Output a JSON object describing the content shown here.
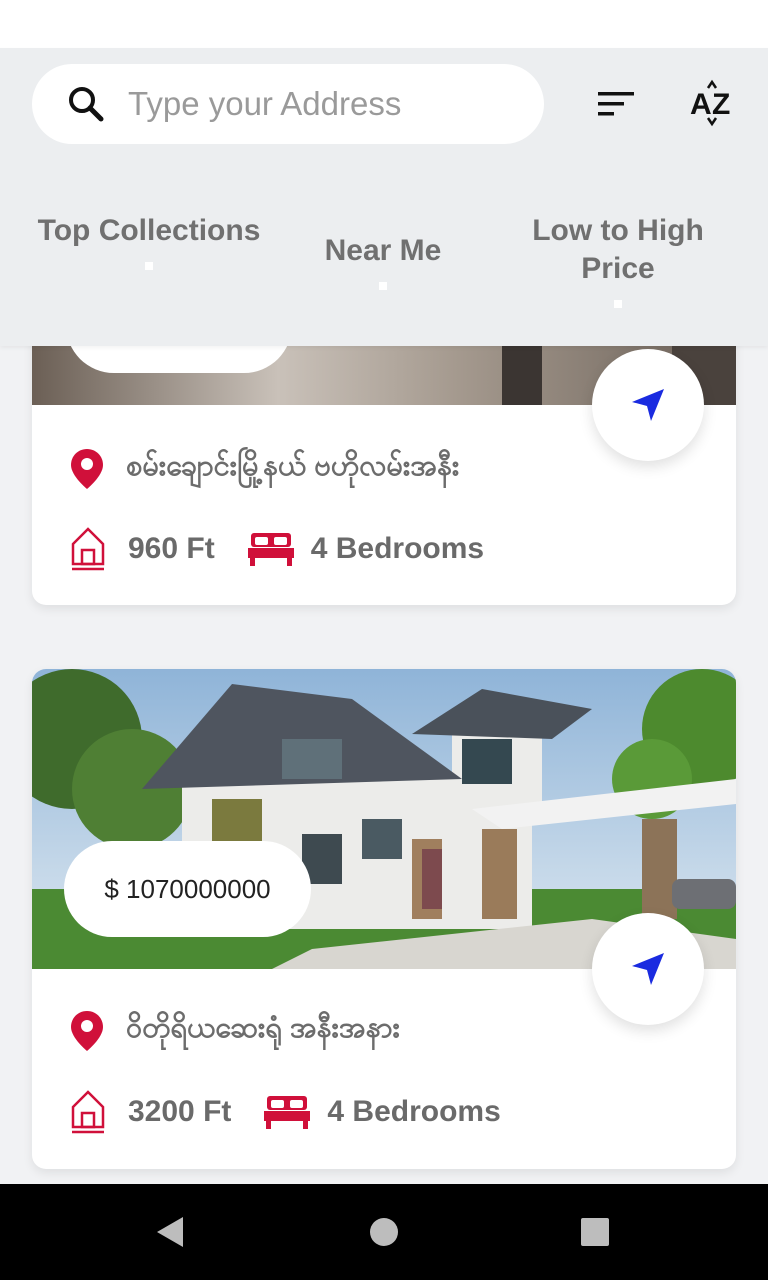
{
  "search": {
    "placeholder": "Type your Address"
  },
  "toolbar": {
    "filter_icon": "filter-icon",
    "sort_icon": "sort-az-icon"
  },
  "tabs": [
    {
      "label": "Top Collections"
    },
    {
      "label": "Near Me"
    },
    {
      "label": "Low to High Price"
    }
  ],
  "listings": [
    {
      "price": "",
      "address": "စမ်းချောင်းမြို့နယ် ဗဟိုလမ်းအနီး",
      "area": "960 Ft",
      "bedrooms": "4 Bedrooms"
    },
    {
      "price": "$ 1070000000",
      "address": "ဝိတိုရိယဆေးရုံ အနီးအနား",
      "area": "3200 Ft",
      "bedrooms": "4 Bedrooms"
    }
  ],
  "colors": {
    "accent": "#d0103a",
    "nav_arrow": "#1a2be0",
    "text_muted": "#707070"
  },
  "system_nav": {
    "back": "back-icon",
    "home": "home-icon",
    "recents": "recents-icon"
  }
}
